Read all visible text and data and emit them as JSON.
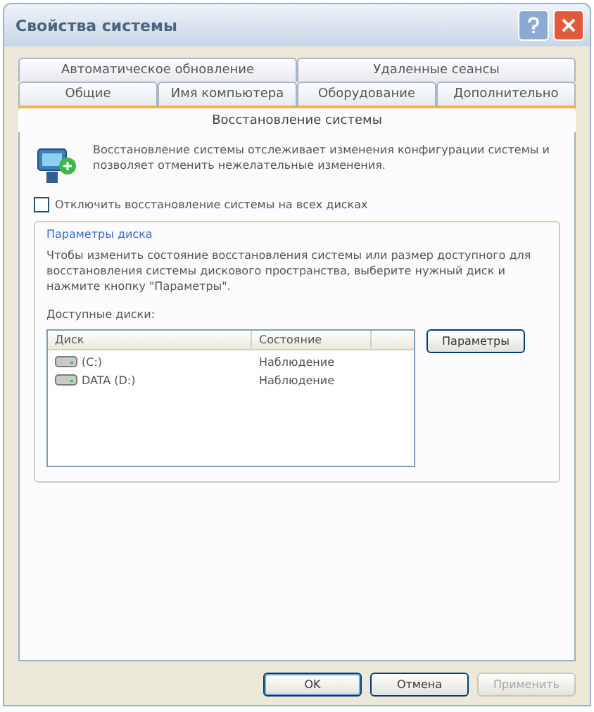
{
  "window": {
    "title": "Свойства системы"
  },
  "tab_rows": [
    {
      "tabs": [
        {
          "label": "Автоматическое обновление",
          "selected": false
        },
        {
          "label": "Удаленные сеансы",
          "selected": false
        }
      ]
    },
    {
      "tabs": [
        {
          "label": "Общие",
          "selected": false
        },
        {
          "label": "Имя компьютера",
          "selected": false
        },
        {
          "label": "Оборудование",
          "selected": false
        },
        {
          "label": "Дополнительно",
          "selected": false
        }
      ]
    },
    {
      "tabs": [
        {
          "label": "Восстановление системы",
          "selected": true
        }
      ]
    }
  ],
  "description": "Восстановление системы отслеживает изменения конфигурации системы и позволяет отменить нежелательные изменения.",
  "disable_checkbox": {
    "label": "Отключить восстановление системы на всех дисках",
    "checked": false
  },
  "disk_group": {
    "title": "Параметры диска",
    "text": "Чтобы изменить состояние восстановления системы или размер доступного для восстановления системы дискового пространства, выберите нужный диск и нажмите кнопку \"Параметры\".",
    "list_label": "Доступные диски:",
    "columns": [
      "Диск",
      "Состояние"
    ],
    "rows": [
      {
        "disk": "(C:)",
        "status": "Наблюдение"
      },
      {
        "disk": "DATA (D:)",
        "status": "Наблюдение"
      }
    ],
    "button": "Параметры"
  },
  "buttons": [
    {
      "label": "OK",
      "disabled": false,
      "default": true
    },
    {
      "label": "Отмена",
      "disabled": false,
      "default": false
    },
    {
      "label": "Применить",
      "disabled": true,
      "default": false
    }
  ]
}
